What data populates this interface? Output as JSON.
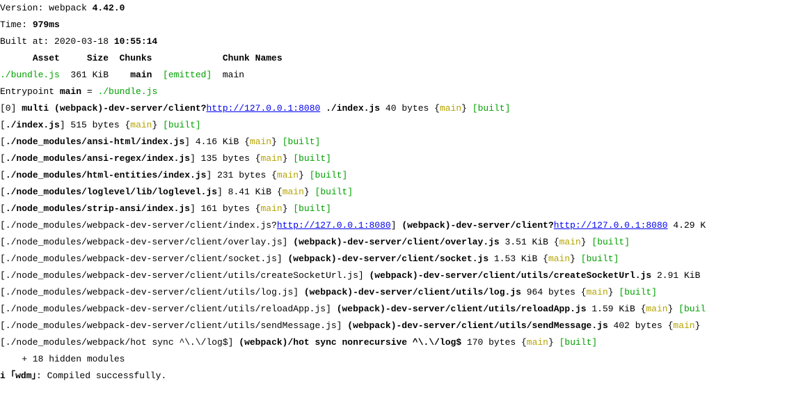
{
  "version_label": "Version: webpack ",
  "version_value": "4.42.0",
  "time_label": "Time: ",
  "time_value": "979ms",
  "built_label": "Built at: 2020-03-18 ",
  "built_time": "10:55:14",
  "table": {
    "h1": "Asset",
    "h2": "Size",
    "h3": "Chunks",
    "h4": "",
    "h5": "Chunk Names",
    "r1": {
      "asset": "./bundle.js",
      "size": "361 KiB",
      "chunks": "main",
      "status": "[emitted]",
      "names": "main"
    }
  },
  "entry_prefix": "Entrypoint ",
  "entry_name": "main",
  "entry_eq": " = ",
  "entry_file": "./bundle.js",
  "m0": {
    "idx": "[0] ",
    "mod": "multi (webpack)-dev-server/client?",
    "url": "http://127.0.0.1:8080",
    "rest": " ./index.js",
    "size": " 40 bytes ",
    "chunk": "main",
    "built": " [built]"
  },
  "mods": [
    {
      "path": "./index.js",
      "size": "] 515 bytes ",
      "chunk": "main",
      "built": " [built]"
    },
    {
      "path": "./node_modules/ansi-html/index.js",
      "size": "] 4.16 KiB ",
      "chunk": "main",
      "built": " [built]"
    },
    {
      "path": "./node_modules/ansi-regex/index.js",
      "size": "] 135 bytes ",
      "chunk": "main",
      "built": " [built]"
    },
    {
      "path": "./node_modules/html-entities/index.js",
      "size": "] 231 bytes ",
      "chunk": "main",
      "built": " [built]"
    },
    {
      "path": "./node_modules/loglevel/lib/loglevel.js",
      "size": "] 8.41 KiB ",
      "chunk": "main",
      "built": " [built]"
    },
    {
      "path": "./node_modules/strip-ansi/index.js",
      "size": "] 161 bytes ",
      "chunk": "main",
      "built": " [built]"
    }
  ],
  "clientIndex": {
    "p1": "[./node_modules/webpack-dev-server/client/index.js?",
    "url1": "http://127.0.0.1:8080",
    "p2": "] ",
    "bold": "(webpack)-dev-server/client?",
    "url2": "http://127.0.0.1:8080",
    "p3": " 4.29 K"
  },
  "clientMods": [
    {
      "p1": "[./node_modules/webpack-dev-server/client/overlay.js] ",
      "bold": "(webpack)-dev-server/client/overlay.js",
      "size": " 3.51 KiB ",
      "chunk": "main",
      "built": " [built]"
    },
    {
      "p1": "[./node_modules/webpack-dev-server/client/socket.js] ",
      "bold": "(webpack)-dev-server/client/socket.js",
      "size": " 1.53 KiB ",
      "chunk": "main",
      "built": " [built]"
    }
  ],
  "createSock": {
    "p1": "[./node_modules/webpack-dev-server/client/utils/createSocketUrl.js] ",
    "bold": "(webpack)-dev-server/client/utils/createSocketUrl.js",
    "size": " 2.91 KiB"
  },
  "logjs": {
    "p1": "[./node_modules/webpack-dev-server/client/utils/log.js] ",
    "bold": "(webpack)-dev-server/client/utils/log.js",
    "size": " 964 bytes ",
    "chunk": "main",
    "built": " [built]"
  },
  "reloadApp": {
    "p1": "[./node_modules/webpack-dev-server/client/utils/reloadApp.js] ",
    "bold": "(webpack)-dev-server/client/utils/reloadApp.js",
    "size": " 1.59 KiB ",
    "chunk": "main",
    "built": " [buil"
  },
  "sendMsg": {
    "p1": "[./node_modules/webpack-dev-server/client/utils/sendMessage.js] ",
    "bold": "(webpack)-dev-server/client/utils/sendMessage.js",
    "size": " 402 bytes ",
    "chunk": "main"
  },
  "hotsync": {
    "p1": "[./node_modules/webpack/hot sync ^\\.\\/log$] ",
    "bold": "(webpack)/hot sync nonrecursive ^\\.\\/log$",
    "size": " 170 bytes ",
    "chunk": "main",
    "built": " [built]"
  },
  "hidden": "    + 18 hidden modules",
  "wdm": {
    "prefix": "i ｢wdm｣",
    "msg": ": Compiled successfully."
  }
}
